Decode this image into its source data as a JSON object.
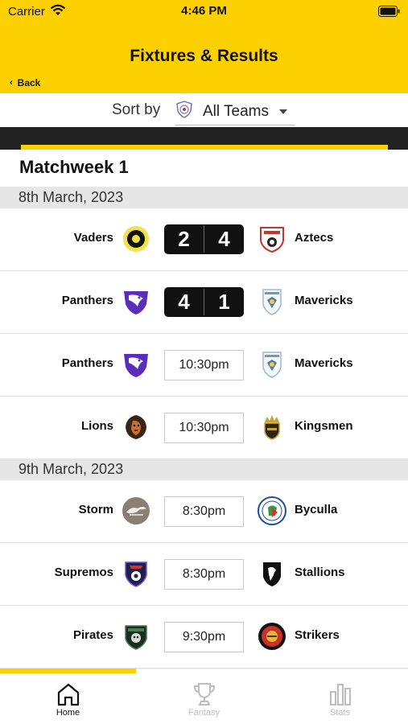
{
  "status_bar": {
    "carrier": "Carrier",
    "time": "4:46 PM"
  },
  "header": {
    "title": "Fixtures & Results",
    "back_label": "Back"
  },
  "sort": {
    "label": "Sort by",
    "selected": "All Teams"
  },
  "matchweek": {
    "title": "Matchweek 1"
  },
  "days": [
    {
      "date": "8th March, 2023",
      "fixtures": [
        {
          "home": "Vaders",
          "away": "Aztecs",
          "home_score": "2",
          "away_score": "4",
          "home_icon": "vaders-logo-icon",
          "away_icon": "aztecs-logo-icon"
        },
        {
          "home": "Panthers",
          "away": "Mavericks",
          "home_score": "4",
          "away_score": "1",
          "home_icon": "panthers-logo-icon",
          "away_icon": "mavericks-logo-icon"
        },
        {
          "home": "Panthers",
          "away": "Mavericks",
          "time": "10:30pm",
          "home_icon": "panthers-logo-icon",
          "away_icon": "mavericks-logo-icon"
        },
        {
          "home": "Lions",
          "away": "Kingsmen",
          "time": "10:30pm",
          "home_icon": "lions-logo-icon",
          "away_icon": "kingsmen-logo-icon"
        }
      ]
    },
    {
      "date": "9th March, 2023",
      "fixtures": [
        {
          "home": "Storm",
          "away": "Byculla",
          "time": "8:30pm",
          "home_icon": "storm-logo-icon",
          "away_icon": "byculla-logo-icon"
        },
        {
          "home": "Supremos",
          "away": "Stallions",
          "time": "8:30pm",
          "home_icon": "supremos-logo-icon",
          "away_icon": "stallions-logo-icon"
        },
        {
          "home": "Pirates",
          "away": "Strikers",
          "time": "9:30pm",
          "home_icon": "pirates-logo-icon",
          "away_icon": "strikers-logo-icon"
        }
      ]
    }
  ],
  "tabs": [
    {
      "label": "Home",
      "icon": "home-icon",
      "active": true
    },
    {
      "label": "Fantasy",
      "icon": "trophy-icon",
      "active": false
    },
    {
      "label": "Stats",
      "icon": "bar-chart-icon",
      "active": false
    }
  ],
  "colors": {
    "brand_yellow": "#FDD100",
    "dark": "#111111",
    "date_bar": "#E6E6E6"
  }
}
